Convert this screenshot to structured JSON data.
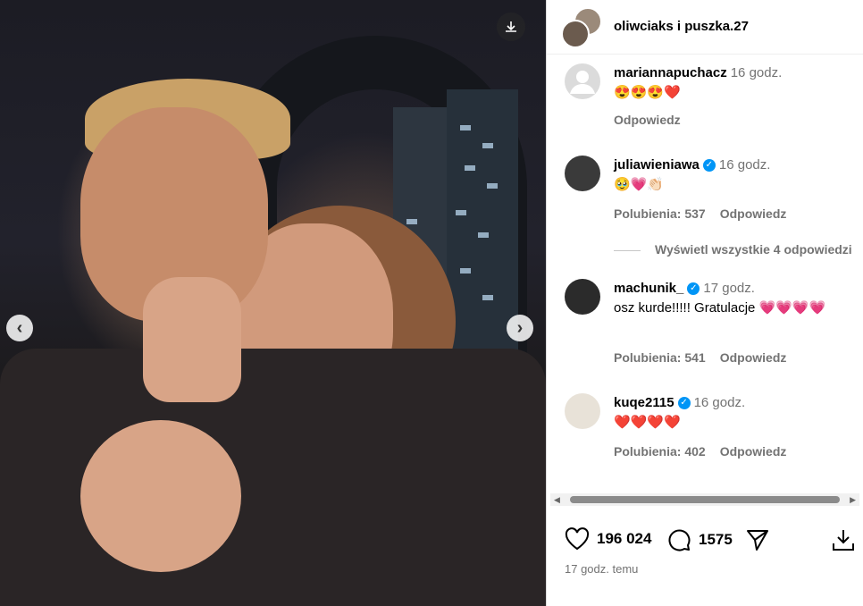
{
  "post": {
    "authors": "oliwciaks i puszka.27",
    "likes": "196 024",
    "comments_count": "1575",
    "time_ago": "17 godz. temu"
  },
  "comments": [
    {
      "user": "mariannapuchacz",
      "verified": false,
      "time": "16 godz.",
      "text": "😍😍😍❤️",
      "likes": "",
      "reply": "Odpowiedz"
    },
    {
      "user": "juliawieniawa",
      "verified": true,
      "time": "16 godz.",
      "text": "🥹💗👏🏻",
      "likes": "Polubienia: 537",
      "reply": "Odpowiedz",
      "view_all": "Wyświetl wszystkie 4 odpowiedzi"
    },
    {
      "user": "machunik_",
      "verified": true,
      "time": "17 godz.",
      "text": "osz kurde!!!!! Gratulacje 💗💗💗💗",
      "likes": "Polubienia: 541",
      "reply": "Odpowiedz"
    },
    {
      "user": "kuqe2115",
      "verified": true,
      "time": "16 godz.",
      "text": "❤️❤️❤️❤️",
      "likes": "Polubienia: 402",
      "reply": "Odpowiedz"
    }
  ],
  "icons": {
    "download": "download-icon",
    "prev": "chevron-left-icon",
    "next": "chevron-right-icon",
    "like": "heart-icon",
    "comment": "comment-icon",
    "share": "send-icon",
    "save": "save-icon"
  }
}
